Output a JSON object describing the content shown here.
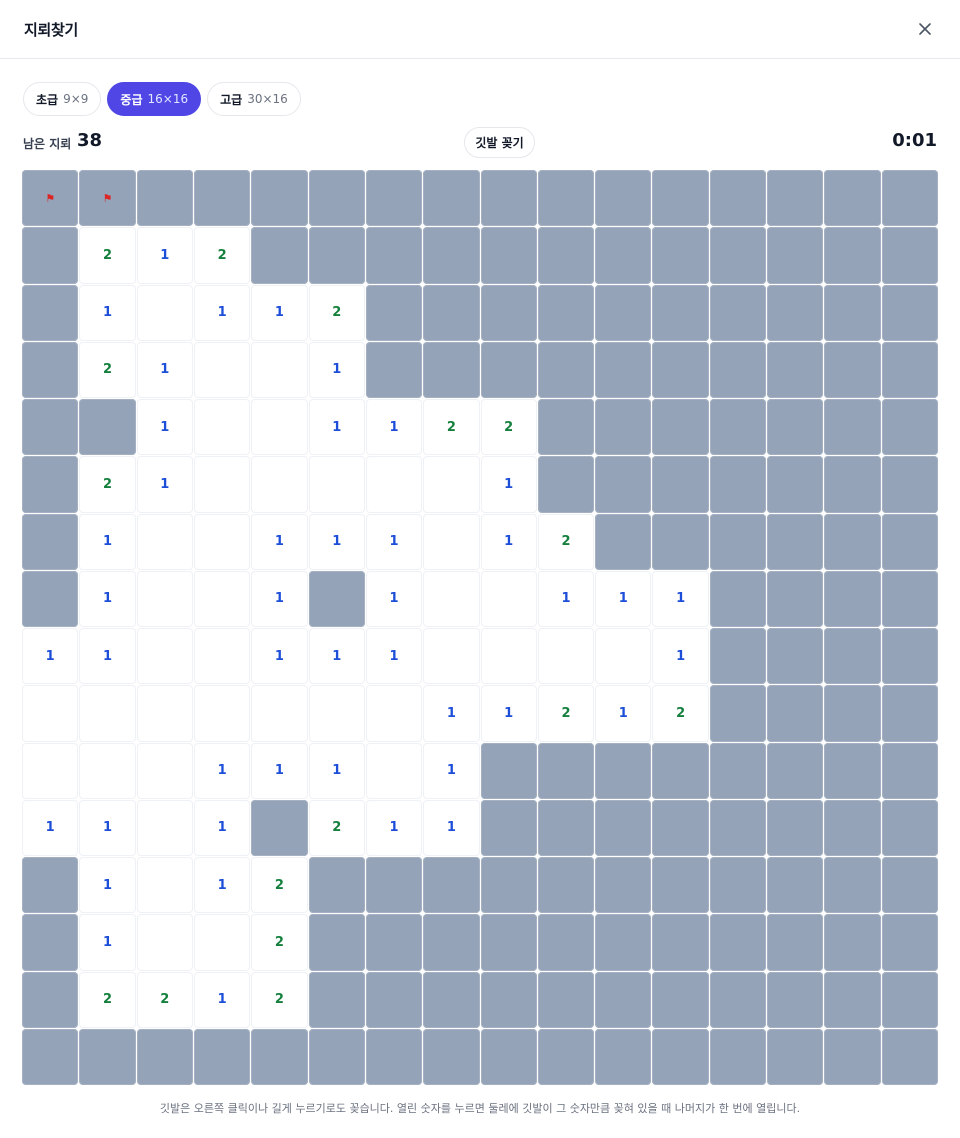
{
  "header": {
    "title": "지뢰찾기",
    "close_icon": "close-icon"
  },
  "tabs": [
    {
      "name": "초급",
      "size": "9×9",
      "active": false
    },
    {
      "name": "중급",
      "size": "16×16",
      "active": true
    },
    {
      "name": "고급",
      "size": "30×16",
      "active": false
    }
  ],
  "status": {
    "mines_label": "남은 지뢰",
    "mines_remaining": "38",
    "flag_button_label": "깃발 꽂기",
    "timer": "0:01"
  },
  "board": {
    "rows": 16,
    "cols": 16,
    "legend": "H = unopened, F = flagged, 0 = open empty, 1-8 = open with count",
    "grid": [
      [
        "F",
        "F",
        "H",
        "H",
        "H",
        "H",
        "H",
        "H",
        "H",
        "H",
        "H",
        "H",
        "H",
        "H",
        "H",
        "H"
      ],
      [
        "H",
        "2",
        "1",
        "2",
        "H",
        "H",
        "H",
        "H",
        "H",
        "H",
        "H",
        "H",
        "H",
        "H",
        "H",
        "H"
      ],
      [
        "H",
        "1",
        "0",
        "1",
        "1",
        "2",
        "H",
        "H",
        "H",
        "H",
        "H",
        "H",
        "H",
        "H",
        "H",
        "H"
      ],
      [
        "H",
        "2",
        "1",
        "0",
        "0",
        "1",
        "H",
        "H",
        "H",
        "H",
        "H",
        "H",
        "H",
        "H",
        "H",
        "H"
      ],
      [
        "H",
        "H",
        "1",
        "0",
        "0",
        "1",
        "1",
        "2",
        "2",
        "H",
        "H",
        "H",
        "H",
        "H",
        "H",
        "H"
      ],
      [
        "H",
        "2",
        "1",
        "0",
        "0",
        "0",
        "0",
        "0",
        "1",
        "H",
        "H",
        "H",
        "H",
        "H",
        "H",
        "H"
      ],
      [
        "H",
        "1",
        "0",
        "0",
        "1",
        "1",
        "1",
        "0",
        "1",
        "2",
        "H",
        "H",
        "H",
        "H",
        "H",
        "H"
      ],
      [
        "H",
        "1",
        "0",
        "0",
        "1",
        "H",
        "1",
        "0",
        "0",
        "1",
        "1",
        "1",
        "H",
        "H",
        "H",
        "H"
      ],
      [
        "1",
        "1",
        "0",
        "0",
        "1",
        "1",
        "1",
        "0",
        "0",
        "0",
        "0",
        "1",
        "H",
        "H",
        "H",
        "H"
      ],
      [
        "0",
        "0",
        "0",
        "0",
        "0",
        "0",
        "0",
        "1",
        "1",
        "2",
        "1",
        "2",
        "H",
        "H",
        "H",
        "H"
      ],
      [
        "0",
        "0",
        "0",
        "1",
        "1",
        "1",
        "0",
        "1",
        "H",
        "H",
        "H",
        "H",
        "H",
        "H",
        "H",
        "H"
      ],
      [
        "1",
        "1",
        "0",
        "1",
        "H",
        "2",
        "1",
        "1",
        "H",
        "H",
        "H",
        "H",
        "H",
        "H",
        "H",
        "H"
      ],
      [
        "H",
        "1",
        "0",
        "1",
        "2",
        "H",
        "H",
        "H",
        "H",
        "H",
        "H",
        "H",
        "H",
        "H",
        "H",
        "H"
      ],
      [
        "H",
        "1",
        "0",
        "0",
        "2",
        "H",
        "H",
        "H",
        "H",
        "H",
        "H",
        "H",
        "H",
        "H",
        "H",
        "H"
      ],
      [
        "H",
        "2",
        "2",
        "1",
        "2",
        "H",
        "H",
        "H",
        "H",
        "H",
        "H",
        "H",
        "H",
        "H",
        "H",
        "H"
      ],
      [
        "H",
        "H",
        "H",
        "H",
        "H",
        "H",
        "H",
        "H",
        "H",
        "H",
        "H",
        "H",
        "H",
        "H",
        "H",
        "H"
      ]
    ],
    "flag_icon": "flag-icon",
    "colors": {
      "hidden": "#94a3b8",
      "one": "#1d4ed8",
      "two": "#15803d",
      "flag": "#dc2626",
      "active_tab": "#4f46e5"
    }
  },
  "footer": {
    "hint": "깃발은 오른쪽 클릭이나 길게 누르기로도 꽂습니다. 열린 숫자를 누르면 둘레에 깃발이 그 숫자만큼 꽂혀 있을 때 나머지가 한 번에 열립니다."
  }
}
